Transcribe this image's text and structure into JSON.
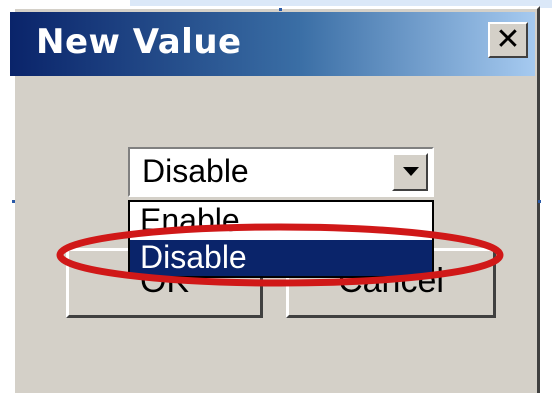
{
  "dialog": {
    "title": "New Value",
    "close_glyph": "✕"
  },
  "combo": {
    "selected_value": "Disable",
    "arrow_icon": "chevron-down-icon"
  },
  "dropdown": {
    "options": [
      {
        "label": "Enable",
        "selected": false
      },
      {
        "label": "Disable",
        "selected": true
      }
    ]
  },
  "buttons": {
    "ok_label": "OK",
    "cancel_label": "Cancel"
  },
  "annotation": {
    "ellipse_color": "#d01818"
  },
  "colors": {
    "titlebar_start": "#0a246a",
    "titlebar_end": "#a6caf0",
    "dialog_face": "#d4d0c8",
    "selection_bg": "#0a246a"
  }
}
